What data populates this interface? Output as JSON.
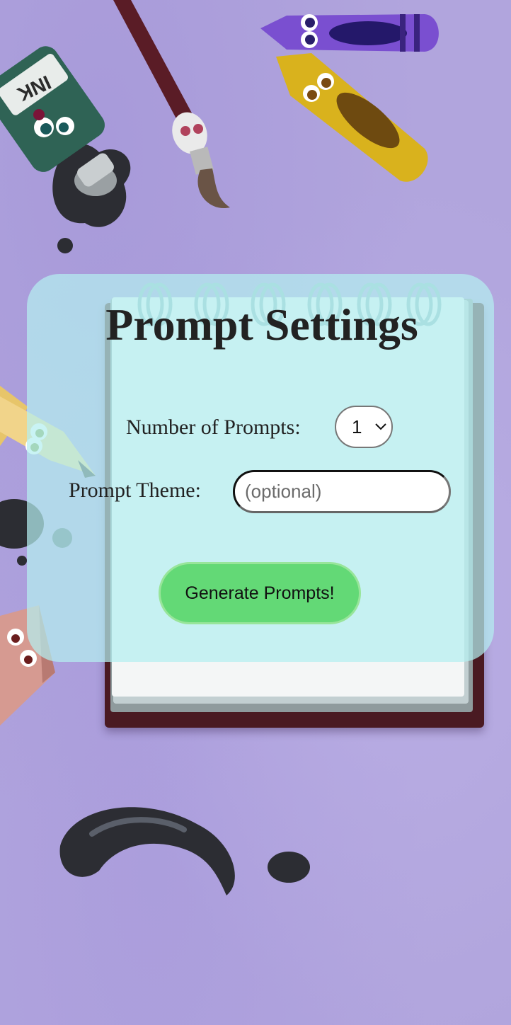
{
  "page": {
    "title": "Prompt Settings"
  },
  "form": {
    "count_label": "Number of Prompts:",
    "count_value": "1",
    "theme_label": "Prompt Theme:",
    "theme_placeholder": "(optional)",
    "theme_value": "",
    "generate_label": "Generate Prompts!"
  },
  "decor": {
    "ink_label": "INK"
  },
  "colors": {
    "background": "#b1a5dd",
    "panel": "#b4eef0",
    "button": "#63d976",
    "button_border": "#98e59a"
  }
}
